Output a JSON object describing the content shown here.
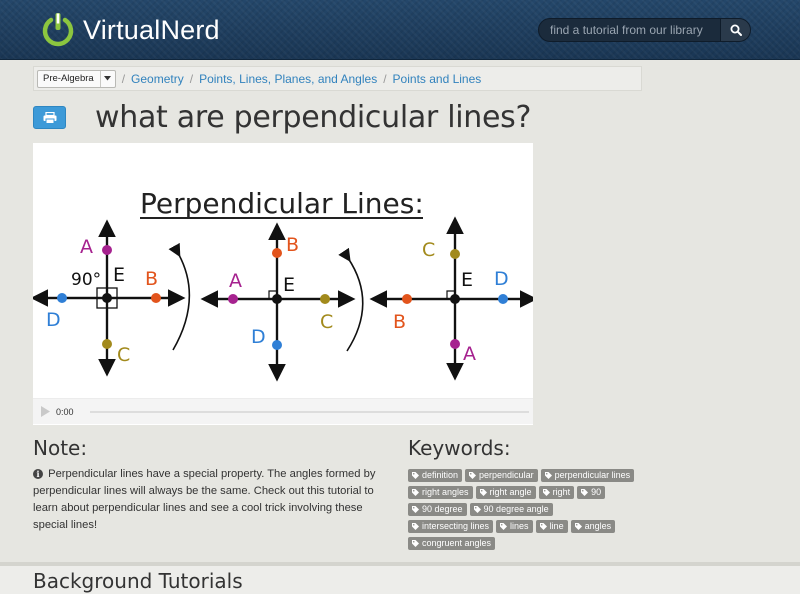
{
  "brand": {
    "name_part1": "Virtual",
    "name_part2": "Nerd"
  },
  "search": {
    "placeholder": "find a tutorial from our library"
  },
  "breadcrumb": {
    "select_value": "Pre-Algebra",
    "items": [
      "Geometry",
      "Points, Lines, Planes, and Angles",
      "Points and Lines"
    ]
  },
  "page_title": "what are perpendicular lines?",
  "video": {
    "slide_title": "Perpendicular Lines:",
    "angle_label": "90°",
    "figure1": {
      "A": "A",
      "E": "E",
      "B": "B",
      "C": "C",
      "D": "D"
    },
    "figure2": {
      "A": "A",
      "E": "E",
      "B": "B",
      "C": "C",
      "D": "D"
    },
    "figure3": {
      "A": "A",
      "E": "E",
      "B": "B",
      "C": "C",
      "D": "D"
    },
    "time": "0:00"
  },
  "note": {
    "heading": "Note:",
    "text": "Perpendicular lines have a special property. The angles formed by perpendicular lines will always be the same. Check out this tutorial to learn about perpendicular lines and see a cool trick involving these special lines!"
  },
  "keywords": {
    "heading": "Keywords:",
    "items": [
      "definition",
      "perpendicular",
      "perpendicular lines",
      "right angles",
      "right angle",
      "right",
      "90",
      "90 degree",
      "90 degree angle",
      "intersecting lines",
      "lines",
      "line",
      "angles",
      "congruent angles"
    ]
  },
  "background_tutorials": {
    "heading": "Background Tutorials"
  },
  "colors": {
    "header_bg": "#1e3c5a",
    "link": "#3182bd",
    "print_button": "#3d9ad8",
    "keyword_bg": "#8a8a86",
    "logo_green": "#8cc63f"
  },
  "icons": [
    "power-logo-icon",
    "search-icon",
    "chevron-down-icon",
    "print-icon",
    "info-icon",
    "tag-icon",
    "play-icon"
  ]
}
